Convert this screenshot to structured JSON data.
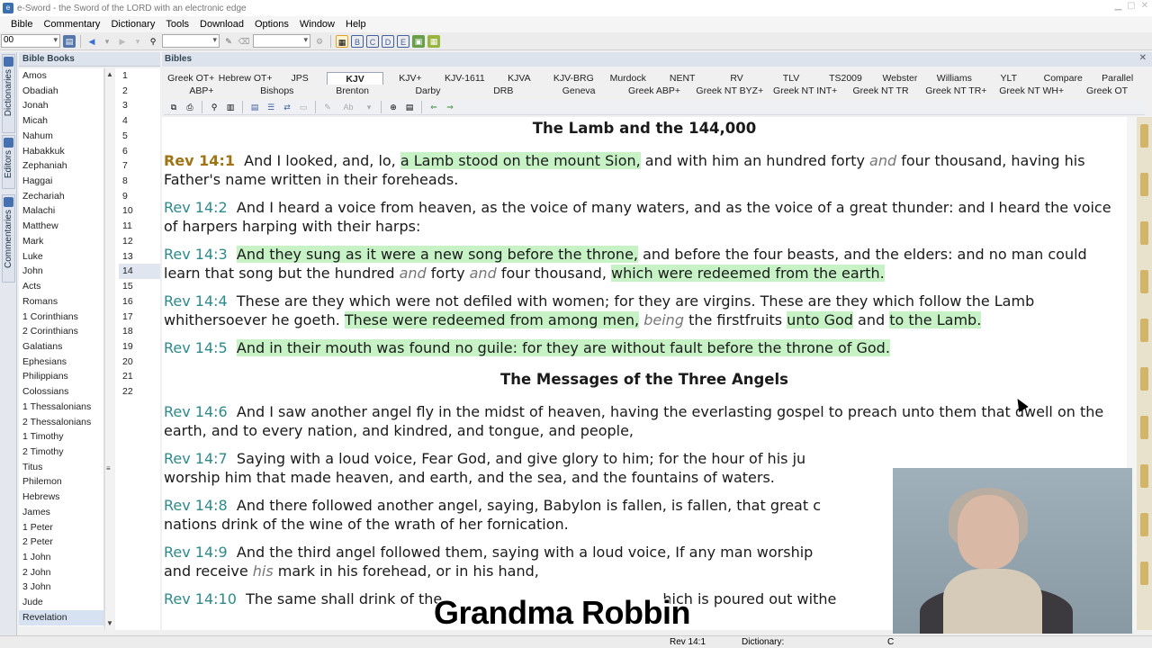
{
  "window": {
    "title": "e-Sword - the Sword of the LORD with an electronic edge"
  },
  "menu": [
    "Bible",
    "Commentary",
    "Dictionary",
    "Tools",
    "Download",
    "Options",
    "Window",
    "Help"
  ],
  "toolbar": {
    "verse_box": "00"
  },
  "sidetabs": [
    "Dictionaries",
    "Editors",
    "Commentaries"
  ],
  "books_pane": {
    "title": "Bible Books",
    "books": [
      "Amos",
      "Obadiah",
      "Jonah",
      "Micah",
      "Nahum",
      "Habakkuk",
      "Zephaniah",
      "Haggai",
      "Zechariah",
      "Malachi",
      "Matthew",
      "Mark",
      "Luke",
      "John",
      "Acts",
      "Romans",
      "1 Corinthians",
      "2 Corinthians",
      "Galatians",
      "Ephesians",
      "Philippians",
      "Colossians",
      "1 Thessalonians",
      "2 Thessalonians",
      "1 Timothy",
      "2 Timothy",
      "Titus",
      "Philemon",
      "Hebrews",
      "James",
      "1 Peter",
      "2 Peter",
      "1 John",
      "2 John",
      "3 John",
      "Jude",
      "Revelation"
    ],
    "selected_book": "Revelation",
    "chapters": [
      "1",
      "2",
      "3",
      "4",
      "5",
      "6",
      "7",
      "8",
      "9",
      "10",
      "11",
      "12",
      "13",
      "14",
      "15",
      "16",
      "17",
      "18",
      "19",
      "20",
      "21",
      "22"
    ],
    "selected_chapter": "14"
  },
  "bibles_pane": {
    "title": "Bibles",
    "tabs_row1": [
      "Greek OT+",
      "Hebrew OT+",
      "JPS",
      "KJV",
      "KJV+",
      "KJV-1611",
      "KJVA",
      "KJV-BRG",
      "Murdock",
      "NENT",
      "RV",
      "TLV",
      "TS2009",
      "Webster",
      "Williams",
      "YLT",
      "Compare",
      "Parallel"
    ],
    "tabs_row2": [
      "ABP+",
      "Bishops",
      "Brenton",
      "Darby",
      "DRB",
      "Geneva",
      "Greek ABP+",
      "Greek NT BYZ+",
      "Greek NT INT+",
      "Greek NT TR",
      "Greek NT TR+",
      "Greek NT WH+",
      "Greek OT"
    ],
    "active_tab": "KJV"
  },
  "passage": {
    "heading1": "The Lamb and the 144,000",
    "heading2": "The Messages of the Three Angels",
    "v1": {
      "ref": "Rev 14:1",
      "a": "And I looked, and, lo, ",
      "b": "a Lamb stood on the mount Sion,",
      "c": " and with him an hundred forty ",
      "d": "and",
      "e": " four thousand, having his Father's name written in their foreheads."
    },
    "v2": {
      "ref": "Rev 14:2",
      "text": "And I heard a voice from heaven, as the voice of many waters, and as the voice of a great thunder: and I heard the voice of harpers harping with their harps:"
    },
    "v3": {
      "ref": "Rev 14:3",
      "a": "And they sung as it were a new song before the throne,",
      "b": " and before the four beasts, and the elders: and no man could learn that song but the hundred ",
      "c": "and",
      "d": " forty ",
      "e": "and",
      "f": " four thousand, ",
      "g": "which were redeemed from the earth."
    },
    "v4": {
      "ref": "Rev 14:4",
      "a": "These are they which were not defiled with women; for they are virgins. These are they which follow the Lamb whithersoever he goeth. ",
      "b": "These were redeemed from among men,",
      "c": " ",
      "d": "being",
      "e": " the firstfruits ",
      "f": "unto God",
      "g": " and ",
      "h": "to the Lamb."
    },
    "v5": {
      "ref": "Rev 14:5",
      "text": "And in their mouth was found no guile: for they are without fault before the throne of God."
    },
    "v6": {
      "ref": "Rev 14:6",
      "text": "And I saw another angel fly in the midst of heaven, having the everlasting gospel to preach unto them that dwell on the earth, and to every nation, and kindred, and tongue, and people,"
    },
    "v7": {
      "ref": "Rev 14:7",
      "text": "Saying with a loud voice, Fear God, and give glory to him; for the hour of his ju",
      "text2": "worship him that made heaven, and earth, and the sea, and the fountains of waters."
    },
    "v8": {
      "ref": "Rev 14:8",
      "text": "And there followed another angel, saying, Babylon is fallen, is fallen, that great c",
      "text2": "nations drink of the wine of the wrath of her fornication."
    },
    "v9": {
      "ref": "Rev 14:9",
      "text": "And the third angel followed them, saying with a loud voice, If any man worship",
      "text2a": "and receive ",
      "text2b": "his",
      "text2c": " mark in his forehead, or in his hand,"
    },
    "v10": {
      "ref": "Rev 14:10",
      "text": "The same shall drink of the",
      "text2": "hich is poured out withe"
    }
  },
  "overlay": {
    "caption": "Grandma Robbin"
  },
  "status": {
    "ref": "Rev 14:1",
    "dictionary": "Dictionary:",
    "extra": "C"
  }
}
